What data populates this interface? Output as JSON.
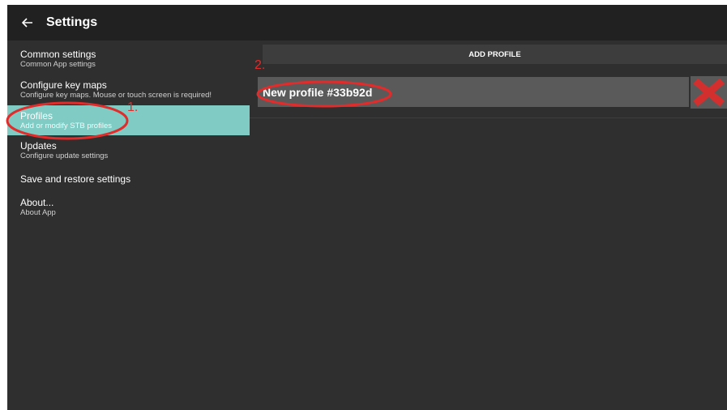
{
  "appbar": {
    "title": "Settings",
    "back_icon": "arrow-left-icon"
  },
  "sidebar": {
    "items": [
      {
        "title": "Common settings",
        "subtitle": "Common App settings",
        "active": false
      },
      {
        "title": "Configure key maps",
        "subtitle": "Configure key maps. Mouse or touch screen is required!",
        "active": false
      },
      {
        "title": "Profiles",
        "subtitle": "Add or modify STB profiles",
        "active": true
      },
      {
        "title": "Updates",
        "subtitle": "Configure update settings",
        "active": false
      },
      {
        "title": "Save and restore settings",
        "subtitle": "",
        "active": false
      },
      {
        "title": "About...",
        "subtitle": "About App",
        "active": false
      }
    ]
  },
  "content": {
    "add_profile_label": "ADD PROFILE",
    "profiles": [
      {
        "name": "New profile #33b92d",
        "delete_icon": "close-icon"
      }
    ]
  },
  "annotations": {
    "step1": "1.",
    "step2": "2.",
    "color": "#e22b2b"
  },
  "colors": {
    "accent": "#80cbc4",
    "appbar": "#212121",
    "background": "#2f2f2f",
    "delete_red": "#d32f2f"
  }
}
